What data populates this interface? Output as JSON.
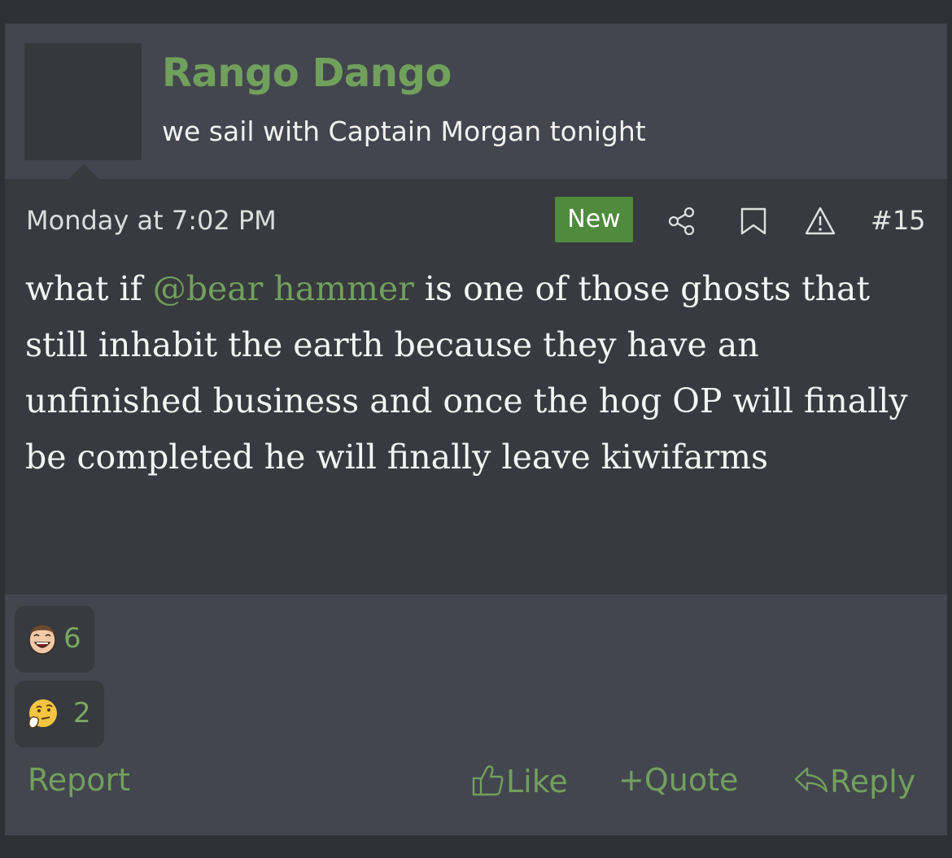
{
  "user": {
    "name": "Rango Dango",
    "title": "we sail with Captain Morgan tonight"
  },
  "meta": {
    "date": "Monday at 7:02 PM",
    "badge": "New",
    "post_number": "#15",
    "icons": [
      "share-icon",
      "bookmark-icon",
      "warning-icon"
    ]
  },
  "message": {
    "before": "what if ",
    "mention": "@bear hammer",
    "after": " is one of those ghosts that still inhabit the earth because they have an unfinished business and once the hog OP will finally be completed he will finally leave kiwifarms"
  },
  "reactions": [
    {
      "icon": "laughing-face-icon",
      "count": "6"
    },
    {
      "icon": "thinking-face-icon",
      "count": "2"
    }
  ],
  "actions": {
    "report": "Report",
    "like": "Like",
    "quote": "Quote",
    "reply": "Reply"
  },
  "colors": {
    "accent": "#71a05c",
    "badge": "#4f8a3d",
    "post_bg": "#43464e",
    "body_bg": "#383a3f"
  }
}
